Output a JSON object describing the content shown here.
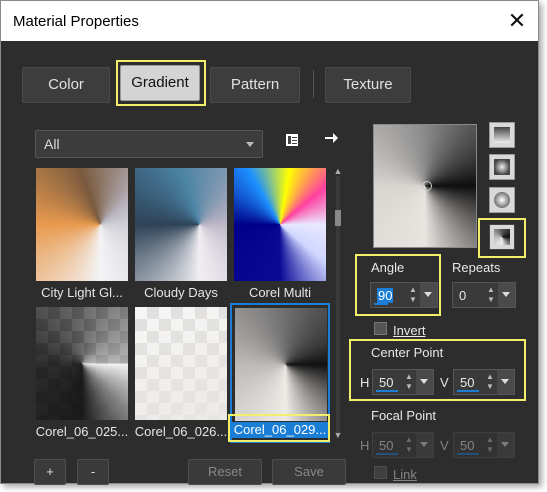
{
  "window": {
    "title": "Material Properties",
    "close_glyph": "✕"
  },
  "tabs": [
    {
      "label": "Color",
      "active": false
    },
    {
      "label": "Gradient",
      "active": true
    },
    {
      "label": "Pattern",
      "active": false
    },
    {
      "label": "Texture",
      "active": false
    }
  ],
  "category_select": {
    "value": "All"
  },
  "toolbar_icons": {
    "preset_options": "preset-options-icon",
    "export": "arrow-right-icon"
  },
  "gradients": [
    {
      "label": "City Light Gl..."
    },
    {
      "label": "Cloudy Days"
    },
    {
      "label": "Corel Multi"
    },
    {
      "label": "Corel_06_025..."
    },
    {
      "label": "Corel_06_026..."
    },
    {
      "label": "Corel_06_029...",
      "selected": true
    }
  ],
  "style_buttons": [
    "linear-style-icon",
    "rectangular-style-icon",
    "sunburst-style-icon",
    "radial-style-icon"
  ],
  "angle": {
    "label": "Angle",
    "value": "90"
  },
  "repeats": {
    "label": "Repeats",
    "value": "0"
  },
  "invert": {
    "label": "Invert",
    "checked": false
  },
  "center_point": {
    "label": "Center Point",
    "h_label": "H",
    "h_value": "50",
    "v_label": "V",
    "v_value": "50"
  },
  "focal_point": {
    "label": "Focal Point",
    "h_label": "H",
    "h_value": "50",
    "v_label": "V",
    "v_value": "50"
  },
  "link": {
    "label": "Link",
    "checked": false
  },
  "buttons": {
    "add": "+",
    "remove": "-",
    "reset": "Reset",
    "save": "Save"
  },
  "colors": {
    "highlight": "#f2ef6b",
    "selection": "#1a7ed6",
    "background": "#2d2d2d"
  }
}
